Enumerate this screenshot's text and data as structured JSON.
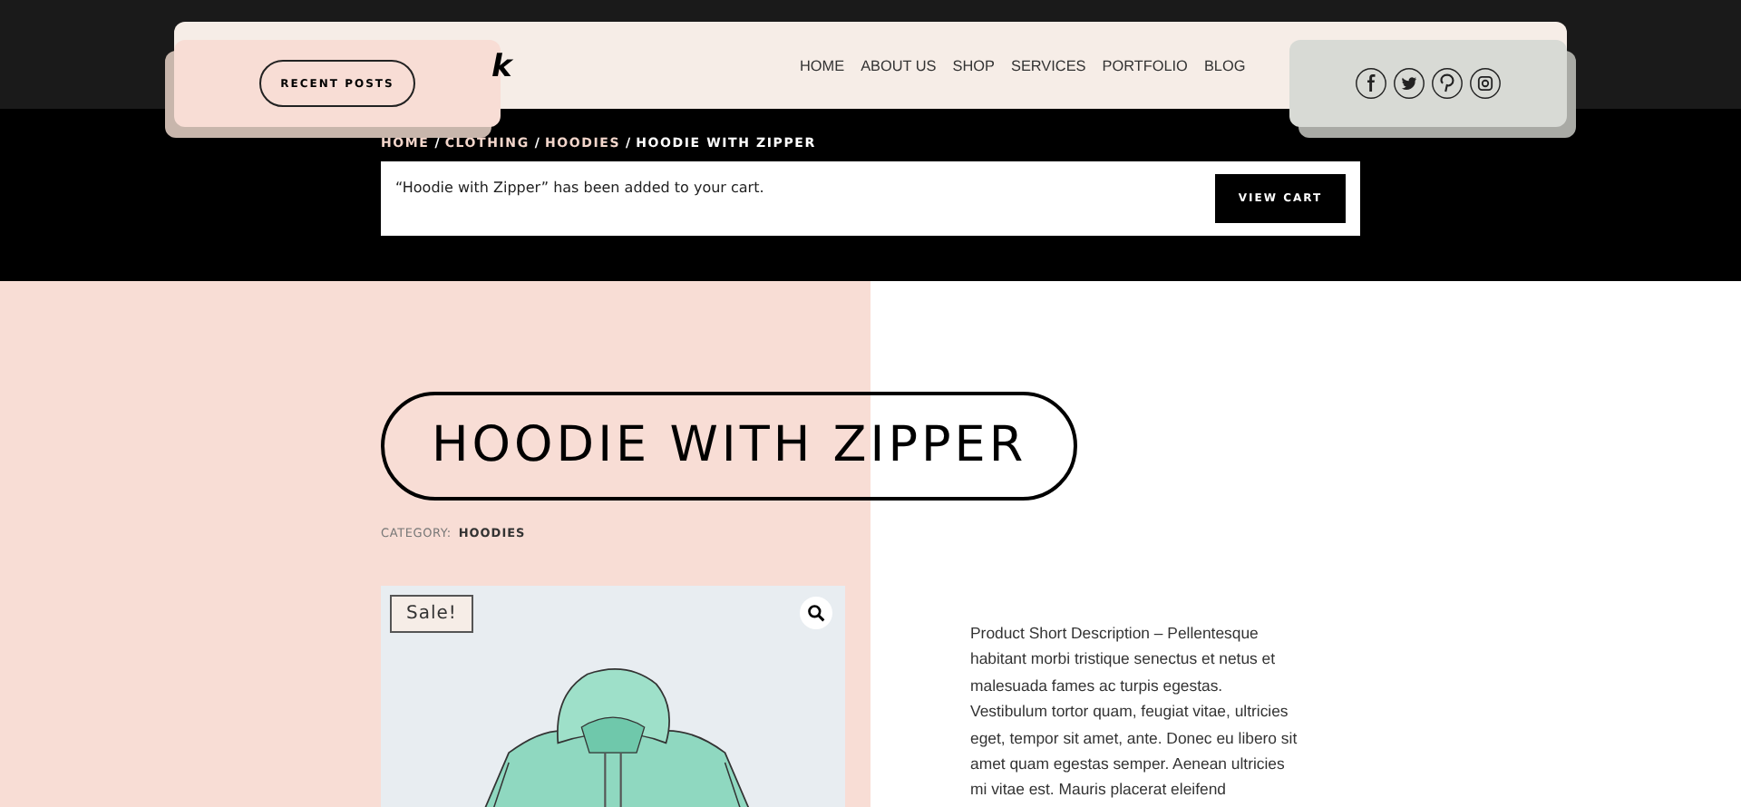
{
  "header": {
    "recent_posts_button": "RECENT POSTS",
    "logo": "k",
    "nav": [
      {
        "label": "HOME",
        "selected": false
      },
      {
        "label": "ABOUT US",
        "selected": false
      },
      {
        "label": "SHOP",
        "selected": false
      },
      {
        "label": "SERVICES",
        "selected": false
      },
      {
        "label": "PORTFOLIO",
        "selected": false
      },
      {
        "label": "BLOG",
        "selected": false
      }
    ],
    "social": [
      {
        "kind": "facebook"
      },
      {
        "kind": "twitter"
      },
      {
        "kind": "pinterest"
      },
      {
        "kind": "instagram"
      }
    ]
  },
  "breadcrumb": {
    "separator": "/",
    "items": [
      "HOME",
      "CLOTHING",
      "HOODIES",
      "HOODIE WITH ZIPPER"
    ]
  },
  "notice": {
    "message": "“Hoodie with Zipper” has been added to your cart.",
    "button": "VIEW CART"
  },
  "product": {
    "title": "HOODIE WITH ZIPPER",
    "category_label": "CATEGORY:",
    "category": "HOODIES",
    "badge": "Sale!",
    "description": "Product Short Description – Pellentesque habitant morbi tristique senectus et netus et malesuada fames ac turpis egestas. Vestibulum tortor quam, feugiat vitae, ultricies eget, tempor sit amet, ante. Donec eu libero sit amet quam egestas semper. Aenean ultricies mi vitae est. Mauris placerat eleifend"
  }
}
